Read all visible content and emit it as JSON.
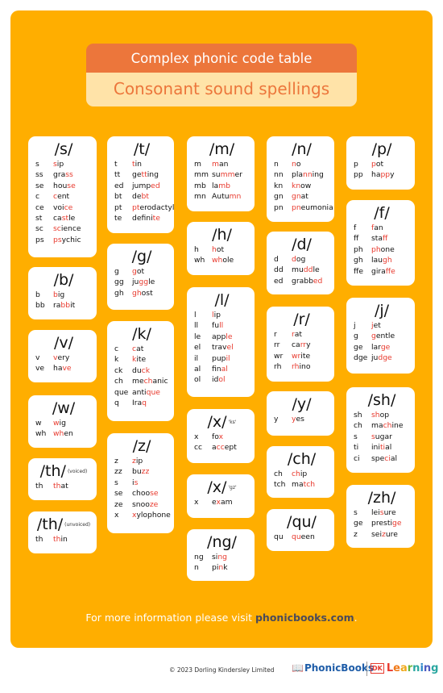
{
  "header": {
    "title": "Complex phonic code table",
    "subtitle": "Consonant sound spellings"
  },
  "colors": {
    "background_panel": "#FFAE00",
    "title_bar": "#EC763B",
    "subtitle_bar": "#FFE3A8",
    "highlight": "#E83A2E"
  },
  "cards": {
    "s": {
      "sound": "/s/",
      "note": "",
      "rows": [
        {
          "g": "s",
          "pre": "",
          "hl": "s",
          "post": "ip"
        },
        {
          "g": "ss",
          "pre": "gra",
          "hl": "ss",
          "post": ""
        },
        {
          "g": "se",
          "pre": "hou",
          "hl": "se",
          "post": ""
        },
        {
          "g": "c",
          "pre": "",
          "hl": "c",
          "post": "ent"
        },
        {
          "g": "ce",
          "pre": "voi",
          "hl": "ce",
          "post": ""
        },
        {
          "g": "st",
          "pre": "ca",
          "hl": "st",
          "post": "le"
        },
        {
          "g": "sc",
          "pre": "",
          "hl": "sc",
          "post": "ience"
        },
        {
          "g": "ps",
          "pre": "",
          "hl": "ps",
          "post": "ychic"
        }
      ]
    },
    "b": {
      "sound": "/b/",
      "note": "",
      "rows": [
        {
          "g": "b",
          "pre": "",
          "hl": "b",
          "post": "ig"
        },
        {
          "g": "bb",
          "pre": "ra",
          "hl": "bb",
          "post": "it"
        }
      ]
    },
    "v": {
      "sound": "/v/",
      "note": "",
      "rows": [
        {
          "g": "v",
          "pre": "",
          "hl": "v",
          "post": "ery"
        },
        {
          "g": "ve",
          "pre": "ha",
          "hl": "ve",
          "post": ""
        }
      ]
    },
    "w": {
      "sound": "/w/",
      "note": "",
      "rows": [
        {
          "g": "w",
          "pre": "",
          "hl": "w",
          "post": "ig"
        },
        {
          "g": "wh",
          "pre": "",
          "hl": "wh",
          "post": "en"
        }
      ]
    },
    "th_voiced": {
      "sound": "/th/",
      "note": "(voiced)",
      "rows": [
        {
          "g": "th",
          "pre": "",
          "hl": "th",
          "post": "at"
        }
      ]
    },
    "th_unvoiced": {
      "sound": "/th/",
      "note": "(unvoiced)",
      "rows": [
        {
          "g": "th",
          "pre": "",
          "hl": "th",
          "post": "in"
        }
      ]
    },
    "t": {
      "sound": "/t/",
      "note": "",
      "rows": [
        {
          "g": "t",
          "pre": "",
          "hl": "t",
          "post": "in"
        },
        {
          "g": "tt",
          "pre": "ge",
          "hl": "tt",
          "post": "ing"
        },
        {
          "g": "ed",
          "pre": "jump",
          "hl": "ed",
          "post": ""
        },
        {
          "g": "bt",
          "pre": "de",
          "hl": "bt",
          "post": ""
        },
        {
          "g": "pt",
          "pre": "",
          "hl": "pt",
          "post": "erodactyl"
        },
        {
          "g": "te",
          "pre": "defini",
          "hl": "te",
          "post": ""
        }
      ]
    },
    "g": {
      "sound": "/g/",
      "note": "",
      "rows": [
        {
          "g": "g",
          "pre": "",
          "hl": "g",
          "post": "ot"
        },
        {
          "g": "gg",
          "pre": "ju",
          "hl": "gg",
          "post": "le"
        },
        {
          "g": "gh",
          "pre": "",
          "hl": "gh",
          "post": "ost"
        }
      ]
    },
    "k": {
      "sound": "/k/",
      "note": "",
      "rows": [
        {
          "g": "c",
          "pre": "",
          "hl": "c",
          "post": "at"
        },
        {
          "g": "k",
          "pre": "",
          "hl": "k",
          "post": "ite"
        },
        {
          "g": "ck",
          "pre": "du",
          "hl": "ck",
          "post": ""
        },
        {
          "g": "ch",
          "pre": "me",
          "hl": "ch",
          "post": "anic"
        },
        {
          "g": "que",
          "pre": "anti",
          "hl": "que",
          "post": ""
        },
        {
          "g": "q",
          "pre": "Ira",
          "hl": "q",
          "post": ""
        }
      ]
    },
    "z": {
      "sound": "/z/",
      "note": "",
      "rows": [
        {
          "g": "z",
          "pre": "",
          "hl": "z",
          "post": "ip"
        },
        {
          "g": "zz",
          "pre": "bu",
          "hl": "zz",
          "post": ""
        },
        {
          "g": "s",
          "pre": "i",
          "hl": "s",
          "post": ""
        },
        {
          "g": "se",
          "pre": "choo",
          "hl": "se",
          "post": ""
        },
        {
          "g": "ze",
          "pre": "snoo",
          "hl": "ze",
          "post": ""
        },
        {
          "g": "x",
          "pre": "",
          "hl": "x",
          "post": "ylophone"
        }
      ]
    },
    "m": {
      "sound": "/m/",
      "note": "",
      "rows": [
        {
          "g": "m",
          "pre": "",
          "hl": "m",
          "post": "an"
        },
        {
          "g": "mm",
          "pre": "su",
          "hl": "mm",
          "post": "er"
        },
        {
          "g": "mb",
          "pre": "la",
          "hl": "mb",
          "post": ""
        },
        {
          "g": "mn",
          "pre": "Autu",
          "hl": "mn",
          "post": ""
        }
      ]
    },
    "h": {
      "sound": "/h/",
      "note": "",
      "rows": [
        {
          "g": "h",
          "pre": "",
          "hl": "h",
          "post": "ot"
        },
        {
          "g": "wh",
          "pre": "",
          "hl": "wh",
          "post": "ole"
        }
      ]
    },
    "l": {
      "sound": "/l/",
      "note": "",
      "rows": [
        {
          "g": "l",
          "pre": "",
          "hl": "l",
          "post": "ip"
        },
        {
          "g": "ll",
          "pre": "fu",
          "hl": "ll",
          "post": ""
        },
        {
          "g": "le",
          "pre": "app",
          "hl": "le",
          "post": ""
        },
        {
          "g": "el",
          "pre": "trav",
          "hl": "el",
          "post": ""
        },
        {
          "g": "il",
          "pre": "pup",
          "hl": "il",
          "post": ""
        },
        {
          "g": "al",
          "pre": "fin",
          "hl": "al",
          "post": ""
        },
        {
          "g": "ol",
          "pre": "id",
          "hl": "ol",
          "post": ""
        }
      ]
    },
    "x_ks": {
      "sound": "/x/",
      "note": "'ks'",
      "rows": [
        {
          "g": "x",
          "pre": "fo",
          "hl": "x",
          "post": ""
        },
        {
          "g": "cc",
          "pre": "a",
          "hl": "cc",
          "post": "ept"
        }
      ]
    },
    "x_gz": {
      "sound": "/x/",
      "note": "'gz'",
      "rows": [
        {
          "g": "x",
          "pre": "e",
          "hl": "x",
          "post": "am"
        }
      ]
    },
    "ng": {
      "sound": "/ng/",
      "note": "",
      "rows": [
        {
          "g": "ng",
          "pre": "si",
          "hl": "ng",
          "post": ""
        },
        {
          "g": "n",
          "pre": "pi",
          "hl": "n",
          "post": "k"
        }
      ]
    },
    "n": {
      "sound": "/n/",
      "note": "",
      "rows": [
        {
          "g": "n",
          "pre": "",
          "hl": "n",
          "post": "o"
        },
        {
          "g": "nn",
          "pre": "pla",
          "hl": "nn",
          "post": "ing"
        },
        {
          "g": "kn",
          "pre": "",
          "hl": "kn",
          "post": "ow"
        },
        {
          "g": "gn",
          "pre": "",
          "hl": "gn",
          "post": "at"
        },
        {
          "g": "pn",
          "pre": "",
          "hl": "pn",
          "post": "eumonia"
        }
      ]
    },
    "d": {
      "sound": "/d/",
      "note": "",
      "rows": [
        {
          "g": "d",
          "pre": "",
          "hl": "d",
          "post": "og"
        },
        {
          "g": "dd",
          "pre": "mu",
          "hl": "dd",
          "post": "le"
        },
        {
          "g": "ed",
          "pre": "grabb",
          "hl": "ed",
          "post": ""
        }
      ]
    },
    "r": {
      "sound": "/r/",
      "note": "",
      "rows": [
        {
          "g": "r",
          "pre": "",
          "hl": "r",
          "post": "at"
        },
        {
          "g": "rr",
          "pre": "ca",
          "hl": "rr",
          "post": "y"
        },
        {
          "g": "wr",
          "pre": "",
          "hl": "wr",
          "post": "ite"
        },
        {
          "g": "rh",
          "pre": "",
          "hl": "rh",
          "post": "ino"
        }
      ]
    },
    "y": {
      "sound": "/y/",
      "note": "",
      "rows": [
        {
          "g": "y",
          "pre": "",
          "hl": "y",
          "post": "es"
        }
      ]
    },
    "ch": {
      "sound": "/ch/",
      "note": "",
      "rows": [
        {
          "g": "ch",
          "pre": "",
          "hl": "ch",
          "post": "ip"
        },
        {
          "g": "tch",
          "pre": "ma",
          "hl": "tch",
          "post": ""
        }
      ]
    },
    "qu": {
      "sound": "/qu/",
      "note": "",
      "rows": [
        {
          "g": "qu",
          "pre": "",
          "hl": "qu",
          "post": "een"
        }
      ]
    },
    "p": {
      "sound": "/p/",
      "note": "",
      "rows": [
        {
          "g": "p",
          "pre": "",
          "hl": "p",
          "post": "ot"
        },
        {
          "g": "pp",
          "pre": "ha",
          "hl": "pp",
          "post": "y"
        }
      ]
    },
    "f": {
      "sound": "/f/",
      "note": "",
      "rows": [
        {
          "g": "f",
          "pre": "",
          "hl": "f",
          "post": "an"
        },
        {
          "g": "ff",
          "pre": "sta",
          "hl": "ff",
          "post": ""
        },
        {
          "g": "ph",
          "pre": "",
          "hl": "ph",
          "post": "one"
        },
        {
          "g": "gh",
          "pre": "lau",
          "hl": "gh",
          "post": ""
        },
        {
          "g": "ffe",
          "pre": "gira",
          "hl": "ffe",
          "post": ""
        }
      ]
    },
    "j": {
      "sound": "/j/",
      "note": "",
      "rows": [
        {
          "g": "j",
          "pre": "",
          "hl": "j",
          "post": "et"
        },
        {
          "g": "g",
          "pre": "",
          "hl": "g",
          "post": "entle"
        },
        {
          "g": "ge",
          "pre": "lar",
          "hl": "ge",
          "post": ""
        },
        {
          "g": "dge",
          "pre": "ju",
          "hl": "dge",
          "post": ""
        }
      ]
    },
    "sh": {
      "sound": "/sh/",
      "note": "",
      "rows": [
        {
          "g": "sh",
          "pre": "",
          "hl": "sh",
          "post": "op"
        },
        {
          "g": "ch",
          "pre": "ma",
          "hl": "ch",
          "post": "ine"
        },
        {
          "g": "s",
          "pre": "",
          "hl": "s",
          "post": "ugar"
        },
        {
          "g": "ti",
          "pre": "ini",
          "hl": "ti",
          "post": "al"
        },
        {
          "g": "ci",
          "pre": "spe",
          "hl": "ci",
          "post": "al"
        }
      ]
    },
    "zh": {
      "sound": "/zh/",
      "note": "",
      "rows": [
        {
          "g": "s",
          "pre": "lei",
          "hl": "s",
          "post": "ure"
        },
        {
          "g": "ge",
          "pre": "presti",
          "hl": "ge",
          "post": ""
        },
        {
          "g": "z",
          "pre": "sei",
          "hl": "z",
          "post": "ure"
        }
      ]
    }
  },
  "footer": {
    "info_text": "For more information please visit ",
    "link_text": "phonicbooks.com",
    "info_end": ".",
    "copyright": "© 2023 Dorling Kindersley Limited",
    "brand_phonic": "PhonicBooks",
    "brand_dk": "DK",
    "brand_learning": "Learning"
  }
}
